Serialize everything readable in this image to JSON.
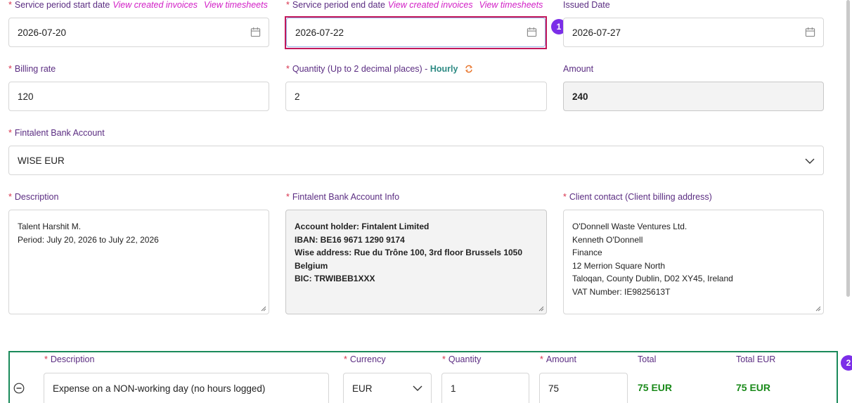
{
  "row1": {
    "start": {
      "label": "Service period start date",
      "link1": "View created invoices",
      "link2": "View timesheets",
      "value": "2026-07-20"
    },
    "end": {
      "label": "Service period end date",
      "link1": "View created invoices",
      "link2": "View timesheets",
      "value": "2026-07-22"
    },
    "issued": {
      "label": "Issued Date",
      "value": "2026-07-27"
    }
  },
  "row2": {
    "rate": {
      "label": "Billing rate",
      "value": "120"
    },
    "quantity": {
      "label": "Quantity (Up to 2 decimal places) -",
      "unit": "Hourly",
      "value": "2"
    },
    "amount": {
      "label": "Amount",
      "value": "240"
    }
  },
  "bank": {
    "label": "Fintalent Bank Account",
    "value": "WISE EUR"
  },
  "row4": {
    "description": {
      "label": "Description",
      "lines": [
        "Talent Harshit M.",
        "Period: July 20, 2026 to July 22, 2026"
      ]
    },
    "bank_info": {
      "label": "Fintalent Bank Account Info",
      "lines": [
        "Account holder: Fintalent Limited",
        "IBAN: BE16 9671 1290 9174",
        "Wise address: Rue du Trône 100, 3rd floor Brussels 1050",
        "Belgium",
        "BIC: TRWIBEB1XXX"
      ]
    },
    "client": {
      "label": "Client contact (Client billing address)",
      "lines": [
        "O'Donnell Waste Ventures Ltd.",
        "Kenneth O'Donnell",
        "Finance",
        "12 Merrion Square North",
        "Taloqan, County Dublin, D02 XY45, Ireland",
        "VAT Number: IE9825613T"
      ]
    }
  },
  "expense": {
    "headers": {
      "description": "Description",
      "currency": "Currency",
      "quantity": "Quantity",
      "amount": "Amount",
      "total": "Total",
      "total_eur": "Total EUR"
    },
    "row": {
      "description": "Expense on a NON-working day (no hours logged)",
      "currency": "EUR",
      "quantity": "1",
      "amount": "75",
      "total": "75 EUR",
      "total_eur": "75 EUR"
    }
  },
  "badges": {
    "one": "1",
    "two": "2"
  },
  "colors": {
    "label": "#5b2d82",
    "required": "#d8324d",
    "link": "#d21fc6",
    "highlight_red": "#c2185b",
    "highlight_green": "#1a8a5a",
    "badge": "#7b2ee8",
    "total_green": "#1a8a1a"
  }
}
